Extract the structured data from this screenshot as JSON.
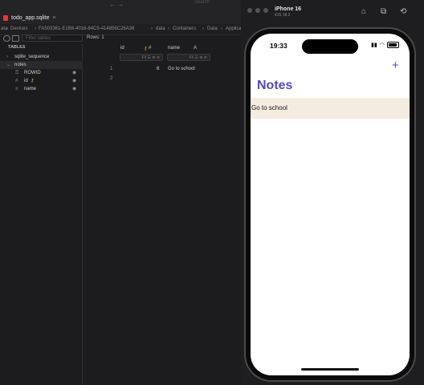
{
  "sqlite": {
    "tab_title": "todo_app.sqlite",
    "tab_close": "×",
    "nav_arrows": "←  →",
    "top_search": "Search",
    "path": [
      "ata",
      "Devices",
      "FA503361-E1B6-4016-84C9-414856C26A36",
      "data",
      "Containers",
      "Data",
      "Application"
    ],
    "path_sep": "›",
    "filter_placeholder": "Filter tables",
    "rows_label": "Rows: 1",
    "sidebar_header": "TABLES",
    "tables": [
      {
        "name": "sqlite_sequence",
        "chevron": "›"
      },
      {
        "name": "notes",
        "chevron": "⌄"
      }
    ],
    "columns": [
      {
        "name": "ROWID",
        "icon": "key",
        "icon_glyph": "⚿"
      },
      {
        "name": "id",
        "icon": "hash",
        "icon_glyph": "#"
      },
      {
        "name": "name",
        "icon": "text",
        "icon_glyph": "≡"
      }
    ],
    "grid_headers": [
      {
        "name": "id",
        "type": "#"
      },
      {
        "name": "name",
        "type": "A"
      }
    ],
    "filter_glyphs": "Fil ☰ ⊕ ⊘",
    "rows": [
      {
        "num": "1",
        "id": "6",
        "name": "Go to school"
      },
      {
        "num": "2",
        "id": "",
        "name": ""
      }
    ]
  },
  "simulator": {
    "device_name": "iPhone 16",
    "os_version": "iOS 18.2",
    "toolbar_icons": [
      "home-icon",
      "screenshot-icon",
      "rotate-icon"
    ],
    "status_time": "19:33",
    "add_label": "+",
    "nav_title": "Notes",
    "notes": [
      "Go to school"
    ]
  }
}
